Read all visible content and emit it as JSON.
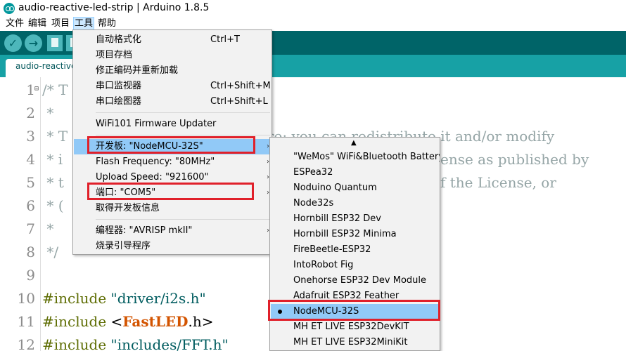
{
  "window": {
    "title": "audio-reactive-led-strip | Arduino 1.8.5"
  },
  "menubar": {
    "items": [
      {
        "label": "文件"
      },
      {
        "label": "编辑"
      },
      {
        "label": "项目"
      },
      {
        "label": "工具"
      },
      {
        "label": "帮助"
      }
    ],
    "active": "工具"
  },
  "toolbar": {
    "verify_icon": "check-icon",
    "upload_icon": "arrow-right-icon",
    "new_icon": "file-icon",
    "verify_glyph": "✓",
    "upload_glyph": "→"
  },
  "tab": {
    "label": "audio-reactive-led-strip"
  },
  "editor": {
    "lines": [
      {
        "num": "1",
        "text": "/* T"
      },
      {
        "num": "2",
        "text": " *"
      },
      {
        "num": "3",
        "text": " * T",
        "tail": "re; you can redistribute it and/or modify"
      },
      {
        "num": "4",
        "text": " * i",
        "tail": "ense as published by"
      },
      {
        "num": "5",
        "text": " * t",
        "tail": "f the License, or"
      },
      {
        "num": "6",
        "text": " * ("
      },
      {
        "num": "7",
        "text": " *"
      },
      {
        "num": "8",
        "text": " */"
      },
      {
        "num": "9",
        "text": ""
      },
      {
        "num": "10",
        "kw": "#include",
        "str": " \"driver/i2s.h\""
      },
      {
        "num": "11",
        "kw": "#include",
        "pre": " <",
        "lib": "FastLED",
        "post": ".h>"
      },
      {
        "num": "12",
        "kw": "#include",
        "str": " \"includes/FFT.h\""
      }
    ],
    "fold_marker": "⊟"
  },
  "tools_menu": {
    "items": [
      {
        "label": "自动格式化",
        "shortcut": "Ctrl+T"
      },
      {
        "label": "项目存档",
        "shortcut": ""
      },
      {
        "label": "修正编码并重新加载",
        "shortcut": ""
      },
      {
        "label": "串口监视器",
        "shortcut": "Ctrl+Shift+M"
      },
      {
        "label": "串口绘图器",
        "shortcut": "Ctrl+Shift+L"
      },
      {
        "label": "WiFi101 Firmware Updater",
        "shortcut": ""
      },
      {
        "label": "开发板: \"NodeMCU-32S\"",
        "submenu": true
      },
      {
        "label": "Flash Frequency: \"80MHz\"",
        "submenu": true
      },
      {
        "label": "Upload Speed: \"921600\"",
        "submenu": true
      },
      {
        "label": "端口: \"COM5\"",
        "submenu": true
      },
      {
        "label": "取得开发板信息",
        "shortcut": ""
      },
      {
        "label": "编程器: \"AVRISP mkII\"",
        "submenu": true
      },
      {
        "label": "烧录引导程序",
        "shortcut": ""
      }
    ],
    "submenu_arrow": "›"
  },
  "board_menu": {
    "scroll_up": "▲",
    "items": [
      {
        "label": "\"WeMos\" WiFi&Bluetooth Battery"
      },
      {
        "label": "ESPea32"
      },
      {
        "label": "Noduino Quantum"
      },
      {
        "label": "Node32s"
      },
      {
        "label": "Hornbill ESP32 Dev"
      },
      {
        "label": "Hornbill ESP32 Minima"
      },
      {
        "label": "FireBeetle-ESP32"
      },
      {
        "label": "IntoRobot Fig"
      },
      {
        "label": "Onehorse ESP32 Dev Module"
      },
      {
        "label": "Adafruit ESP32 Feather"
      },
      {
        "label": "NodeMCU-32S",
        "selected": true
      },
      {
        "label": "MH ET LIVE ESP32DevKIT"
      },
      {
        "label": "MH ET LIVE ESP32MiniKit"
      }
    ]
  },
  "colors": {
    "toolbar": "#006468",
    "tabstrip": "#17a1a5",
    "highlight": "#91c9f7",
    "annotation_red": "#e0202a"
  }
}
